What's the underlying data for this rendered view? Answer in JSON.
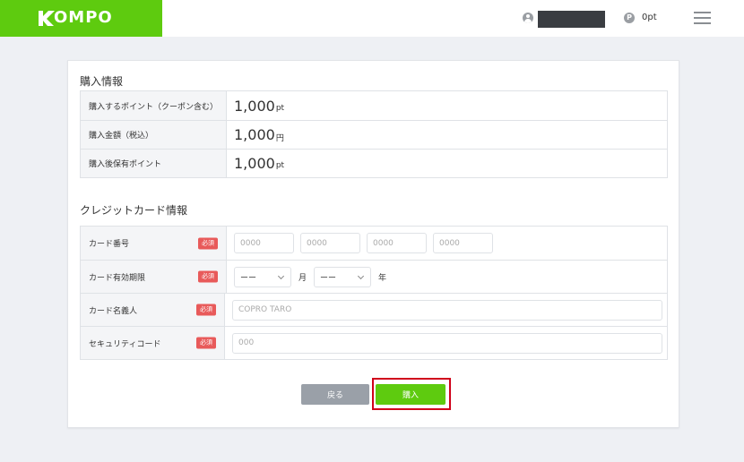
{
  "header": {
    "logo_text": "KOMPO",
    "points": "0pt",
    "icons": [
      "user-icon",
      "point-icon",
      "hamburger-menu-icon"
    ],
    "point_icon_glyph": "P"
  },
  "purchase_info": {
    "title": "購入情報",
    "rows": [
      {
        "label": "購入するポイント（クーポン含む）",
        "value": "1,000",
        "unit": "pt"
      },
      {
        "label": "購入金額（税込）",
        "value": "1,000",
        "unit": "円"
      },
      {
        "label": "購入後保有ポイント",
        "value": "1,000",
        "unit": "pt"
      }
    ]
  },
  "card_info": {
    "title": "クレジットカード情報",
    "required_badge": "必須",
    "card_number": {
      "label": "カード番号",
      "placeholders": [
        "0000",
        "0000",
        "0000",
        "0000"
      ]
    },
    "expiry": {
      "label": "カード有効期限",
      "month_value": "ーー",
      "month_unit": "月",
      "year_value": "ーー",
      "year_unit": "年"
    },
    "holder": {
      "label": "カード名義人",
      "placeholder": "COPRO TARO"
    },
    "security": {
      "label": "セキュリティコード",
      "placeholder": "000"
    }
  },
  "buttons": {
    "back": "戻る",
    "buy": "購入"
  },
  "colors": {
    "brand_green": "#5ecb0f",
    "required_red": "#e85a5a",
    "highlight_red": "#d0021b",
    "back_gray": "#9aa0a8"
  }
}
